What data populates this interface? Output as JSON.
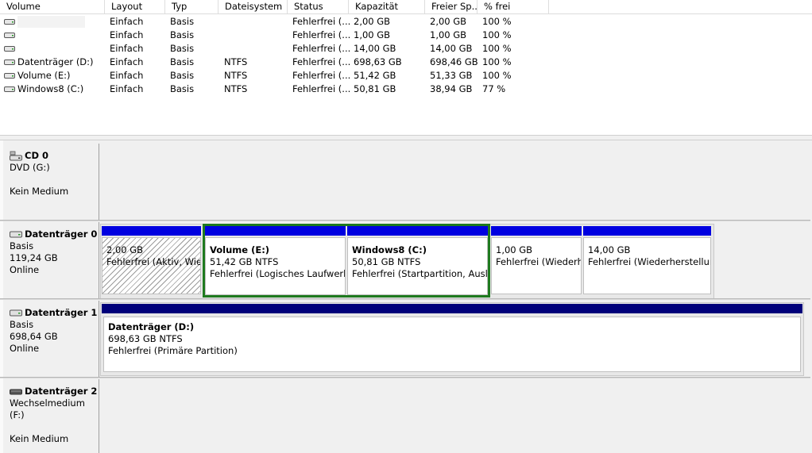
{
  "colors": {
    "primary_bar": "#0000e0",
    "logical_bar": "#00007a",
    "selection": "#1f7a1f"
  },
  "columns": [
    "Volume",
    "Layout",
    "Typ",
    "Dateisystem",
    "Status",
    "Kapazität",
    "Freier Sp...",
    "% frei"
  ],
  "volumes": [
    {
      "name": "",
      "layout": "Einfach",
      "typ": "Basis",
      "fs": "",
      "status": "Fehlerfrei (...",
      "cap": "2,00 GB",
      "free": "2,00 GB",
      "pct": "100 %"
    },
    {
      "name": "",
      "layout": "Einfach",
      "typ": "Basis",
      "fs": "",
      "status": "Fehlerfrei (...",
      "cap": "1,00 GB",
      "free": "1,00 GB",
      "pct": "100 %"
    },
    {
      "name": "",
      "layout": "Einfach",
      "typ": "Basis",
      "fs": "",
      "status": "Fehlerfrei (...",
      "cap": "14,00 GB",
      "free": "14,00 GB",
      "pct": "100 %"
    },
    {
      "name": "Datenträger (D:)",
      "layout": "Einfach",
      "typ": "Basis",
      "fs": "NTFS",
      "status": "Fehlerfrei (...",
      "cap": "698,63 GB",
      "free": "698,46 GB",
      "pct": "100 %"
    },
    {
      "name": "Volume (E:)",
      "layout": "Einfach",
      "typ": "Basis",
      "fs": "NTFS",
      "status": "Fehlerfrei (...",
      "cap": "51,42 GB",
      "free": "51,33 GB",
      "pct": "100 %"
    },
    {
      "name": "Windows8 (C:)",
      "layout": "Einfach",
      "typ": "Basis",
      "fs": "NTFS",
      "status": "Fehlerfrei (...",
      "cap": "50,81 GB",
      "free": "38,94 GB",
      "pct": "77 %"
    }
  ],
  "disks": {
    "cd0": {
      "title": "CD 0",
      "line1": "DVD (G:)",
      "line3": "Kein Medium"
    },
    "disk0": {
      "title": "Datenträger 0",
      "type": "Basis",
      "size": "119,24 GB",
      "state": "Online",
      "partitions": [
        {
          "name": "",
          "size": "2,00 GB",
          "status": "Fehlerfrei (Aktiv, Wiederherstellungspartition)"
        },
        {
          "name": "Volume  (E:)",
          "size": "51,42 GB NTFS",
          "status": "Fehlerfrei (Logisches Laufwerk)"
        },
        {
          "name": "Windows8  (C:)",
          "size": "50,81 GB NTFS",
          "status": "Fehlerfrei (Startpartition, Auslagerungsdatei)"
        },
        {
          "name": "",
          "size": "1,00 GB",
          "status": "Fehlerfrei (Wiederherstellungspartition)"
        },
        {
          "name": "",
          "size": "14,00 GB",
          "status": "Fehlerfrei (Wiederherstellungspartition)"
        }
      ]
    },
    "disk1": {
      "title": "Datenträger 1",
      "type": "Basis",
      "size": "698,64 GB",
      "state": "Online",
      "partition": {
        "name": "Datenträger  (D:)",
        "size": "698,63 GB NTFS",
        "status": "Fehlerfrei (Primäre Partition)"
      }
    },
    "disk2": {
      "title": "Datenträger 2",
      "line1": "Wechselmedium (F:)",
      "line3": "Kein Medium"
    }
  }
}
